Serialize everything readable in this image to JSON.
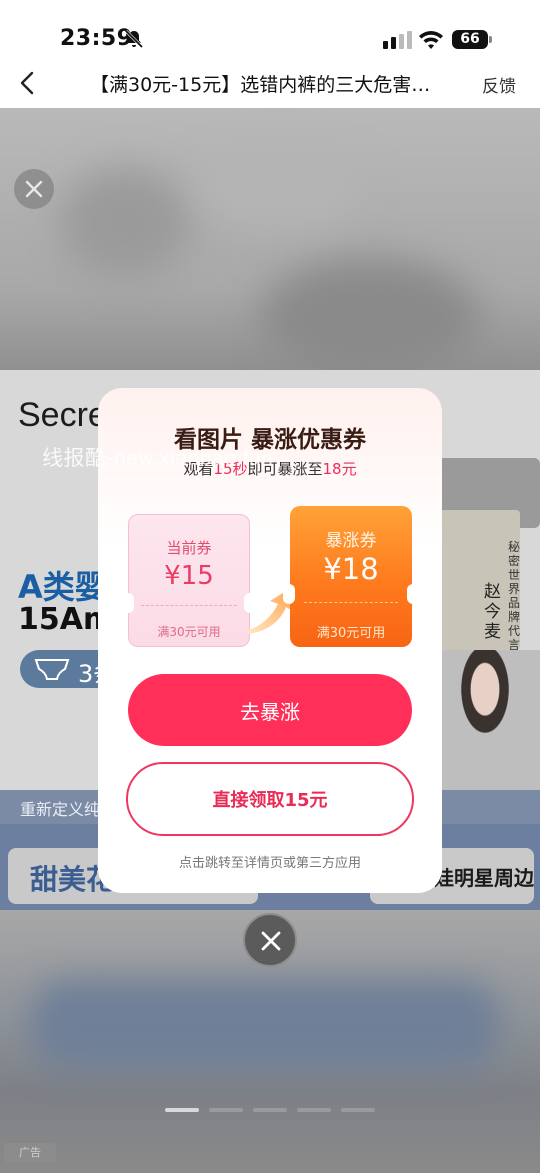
{
  "status_bar": {
    "time": "23:59",
    "battery": "66"
  },
  "nav": {
    "title": "【满30元-15元】选错内裤的三大危害…",
    "feedback": "反馈"
  },
  "background": {
    "brand": "Secre",
    "watermark": "线报酷-new.xianbao.fun",
    "headline": "A类婴",
    "subline": "15Ama",
    "pill_text": "3条",
    "endorsement": "秘密世界品牌代言人",
    "endorser_name": "赵今麦",
    "strip_text": "重新定义纯",
    "box_left": "甜美花",
    "box_right": "娃明星周边",
    "ad_tag": "广告"
  },
  "modal": {
    "title": "看图片 暴涨优惠券",
    "subtitle_prefix": "观看",
    "subtitle_seconds": "15秒",
    "subtitle_mid": "即可暴涨至",
    "subtitle_amount": "18元",
    "current_coupon": {
      "label": "当前券",
      "amount": "¥15",
      "condition": "满30元可用"
    },
    "boosted_coupon": {
      "label": "暴涨券",
      "amount": "¥18",
      "condition": "满30元可用"
    },
    "primary_button": "去暴涨",
    "secondary_button": "直接领取15元",
    "footer_note": "点击跳转至详情页或第三方应用"
  },
  "carousel": {
    "count": 5,
    "active_index": 0
  },
  "colors": {
    "accent": "#ff2f5a",
    "orange": "#ff7a1d",
    "brand_blue": "#1a5ea4"
  }
}
